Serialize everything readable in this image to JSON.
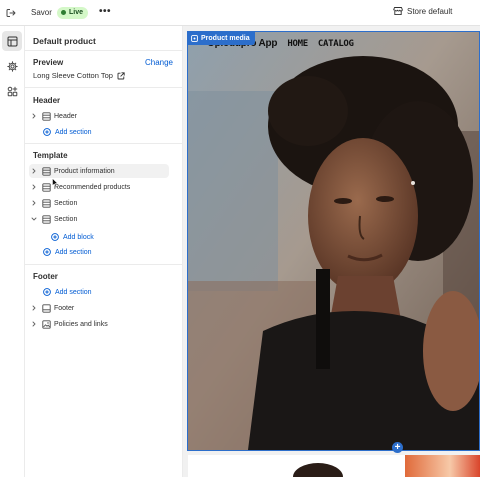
{
  "topbar": {
    "theme_name": "Savor",
    "status_badge": "Live",
    "more_label": "•••",
    "store_label": "Store default"
  },
  "sidebar": {
    "page_title": "Default product",
    "preview": {
      "heading": "Preview",
      "change_label": "Change",
      "value": "Long Sleeve Cotton Top"
    },
    "header": {
      "heading": "Header",
      "items": [
        {
          "label": "Header",
          "icon": "section-icon"
        }
      ],
      "add_section": "Add section"
    },
    "template": {
      "heading": "Template",
      "items": [
        {
          "label": "Product information",
          "icon": "section-icon"
        },
        {
          "label": "Recommended products",
          "icon": "section-icon"
        },
        {
          "label": "Section",
          "icon": "section-icon"
        },
        {
          "label": "Section",
          "icon": "section-icon",
          "expanded": true
        }
      ],
      "add_block": "Add block",
      "add_section": "Add section"
    },
    "footer": {
      "heading": "Footer",
      "add_section": "Add section",
      "items": [
        {
          "label": "Footer",
          "icon": "section-icon"
        },
        {
          "label": "Policies and links",
          "icon": "image-section-icon"
        }
      ]
    }
  },
  "preview_canvas": {
    "selection_label": "Product media",
    "store_brand": "Opiodupro App",
    "nav_links": [
      "HOME",
      "CATALOG"
    ]
  },
  "colors": {
    "accent": "#005bd3",
    "selection": "#2c6ecb",
    "live_badge_bg": "#d4f8c8",
    "live_dot": "#2e7d32"
  }
}
